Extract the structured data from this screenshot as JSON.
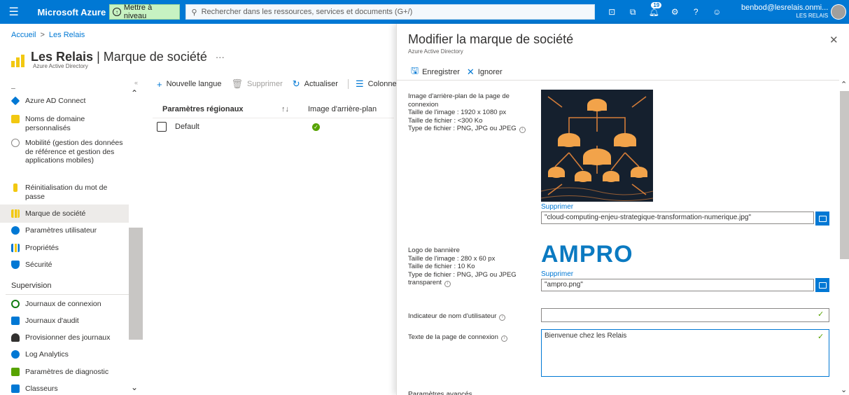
{
  "topbar": {
    "brand": "Microsoft Azure",
    "upgrade_label": "Mettre à niveau",
    "search_placeholder": "Rechercher dans les ressources, services et documents (G+/)",
    "notification_count": "19",
    "user_email": "benbod@lesrelais.onmi...",
    "user_tenant": "LES RELAIS",
    "icons": [
      "menu-icon",
      "upgrade-icon",
      "search-icon",
      "cloud-shell-icon",
      "directory-filter-icon",
      "notifications-icon",
      "settings-icon",
      "help-icon",
      "feedback-icon"
    ]
  },
  "breadcrumb": {
    "home": "Accueil",
    "current": "Les Relais",
    "separator": ">"
  },
  "page": {
    "title_bold": "Les Relais",
    "title_sep": " | ",
    "title_rest": "Marque de société",
    "more": "···",
    "subtitle": "Azure Active Directory",
    "collapse_glyph": "«"
  },
  "sidebar": {
    "items": [
      {
        "label": "Azure AD Connect",
        "color": "#0078d4"
      },
      {
        "label": "Noms de domaine personnalisés",
        "color": "#f2c811"
      },
      {
        "label": "Mobilité (gestion des données de référence et gestion des applications mobiles)",
        "color": "#8a8886"
      },
      {
        "label": "Réinitialisation du mot de passe",
        "color": "#f2c811"
      },
      {
        "label": "Marque de société",
        "color": "#f2c811"
      },
      {
        "label": "Paramètres utilisateur",
        "color": "#0078d4"
      },
      {
        "label": "Propriétés",
        "color": "#0078d4"
      },
      {
        "label": "Sécurité",
        "color": "#0078d4"
      }
    ],
    "section": "Supervision",
    "monitoring": [
      {
        "label": "Journaux de connexion",
        "color": "#107c10"
      },
      {
        "label": "Journaux d'audit",
        "color": "#0078d4"
      },
      {
        "label": "Provisionner des journaux",
        "color": "#323130"
      },
      {
        "label": "Log Analytics",
        "color": "#0078d4"
      },
      {
        "label": "Paramètres de diagnostic",
        "color": "#57a300"
      },
      {
        "label": "Classeurs",
        "color": "#0078d4"
      }
    ]
  },
  "toolbar": {
    "new_language": "Nouvelle langue",
    "delete": "Supprimer",
    "refresh": "Actualiser",
    "columns": "Colonnes"
  },
  "grid": {
    "col_locale": "Paramètres régionaux",
    "sort_glyph": "↑↓",
    "col_background": "Image d'arrière-plan",
    "row_locale": "Default"
  },
  "panel": {
    "title": "Modifier la marque de société",
    "subtitle": "Azure Active Directory",
    "save": "Enregistrer",
    "discard": "Ignorer",
    "bg_label_1": "Image d'arrière-plan de la page de connexion",
    "bg_label_2": "Taille de l'image : 1920 x 1080 px",
    "bg_label_3": "Taille de fichier : <300 Ko",
    "bg_label_4": "Type de fichier : PNG, JPG ou JPEG",
    "bg_remove": "Supprimer",
    "bg_file": "\"cloud-computing-enjeu-strategique-transformation-numerique.jpg\"",
    "logo_label_1": "Logo de bannière",
    "logo_label_2": "Taille de l'image : 280 x 60 px",
    "logo_label_3": "Taille de fichier : 10 Ko",
    "logo_label_4": "Type de fichier : PNG, JPG ou JPEG",
    "logo_label_5": "transparent",
    "logo_text": "AMPRO",
    "logo_remove": "Supprimer",
    "logo_file": "\"ampro.png\"",
    "username_hint_label": "Indicateur de nom d'utilisateur",
    "username_hint_value": "",
    "signin_text_label": "Texte de la page de connexion",
    "signin_text_value": "Bienvenue chez les Relais",
    "next_section_label": "Paramètres avancés"
  }
}
